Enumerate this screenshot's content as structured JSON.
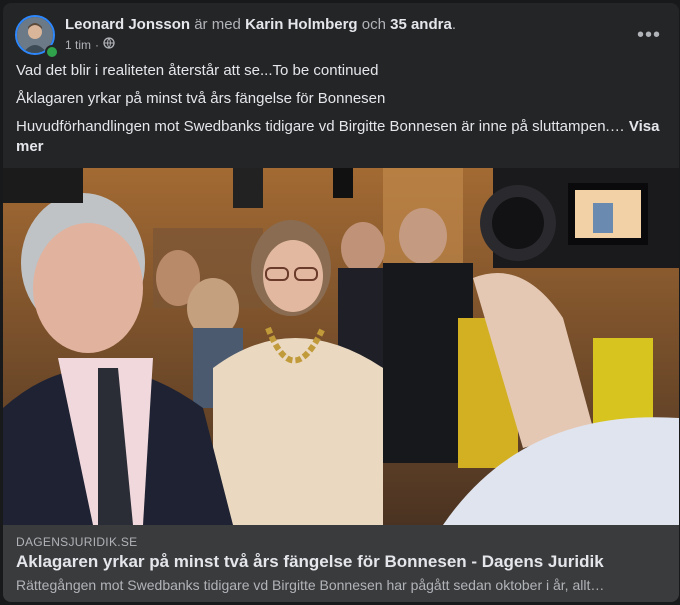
{
  "post": {
    "author": "Leonard Jonsson",
    "with_word": " är med ",
    "tagged": "Karin Holmberg",
    "and_word": " och ",
    "others": "35 andra",
    "period": ".",
    "time": "1 tim",
    "separator": "·",
    "privacy_icon": "globe-icon",
    "more_icon": "more-horizontal-icon",
    "more_label": "•••",
    "line1": "Vad det blir i realiteten återstår att se...To be continued",
    "line2": "Åklagaren yrkar på minst två års fängelse för Bonnesen",
    "line3": "Huvudförhandlingen mot Swedbanks tidigare vd Birgitte Bonnesen är inne på sluttampen.…",
    "see_more": "Visa mer"
  },
  "link_preview": {
    "domain": "DAGENSJURIDIK.SE",
    "title": "Aklagaren yrkar på minst två års fängelse för Bonnesen - Dagens Juridik",
    "description": "Rättegången mot Swedbanks tidigare vd Birgitte Bonnesen har pågått sedan oktober i år, allt…"
  },
  "colors": {
    "card_bg": "#242526",
    "link_bg": "#3a3b3c",
    "online": "#31a24c",
    "text_primary": "#e4e6eb",
    "text_secondary": "#b0b3b8"
  }
}
